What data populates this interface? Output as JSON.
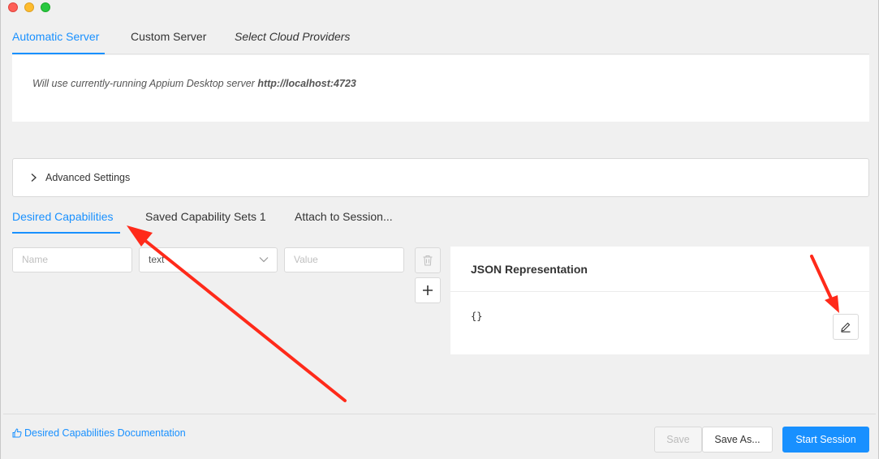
{
  "window": {
    "controls": [
      "close-button",
      "minimize-button",
      "maximize-button"
    ]
  },
  "server_tabs": [
    {
      "label": "Automatic Server",
      "active": true
    },
    {
      "label": "Custom Server",
      "active": false
    },
    {
      "label": "Select Cloud Providers",
      "active": false
    }
  ],
  "server_info": {
    "prefix": "Will use currently-running Appium Desktop server ",
    "url": "http://localhost:4723"
  },
  "advanced_settings": {
    "label": "Advanced Settings",
    "icon": "chevron-right-icon",
    "expanded": false
  },
  "capability_tabs": [
    {
      "label": "Desired Capabilities",
      "active": true
    },
    {
      "label": "Saved Capability Sets 1",
      "active": false
    },
    {
      "label": "Attach to Session...",
      "active": false
    }
  ],
  "capability_row": {
    "name_placeholder": "Name",
    "type_value": "text",
    "value_placeholder": "Value",
    "delete_icon": "trash-icon",
    "add_icon": "plus-icon"
  },
  "json_panel": {
    "title": "JSON Representation",
    "content": "{}",
    "edit_icon": "pencil-icon"
  },
  "footer": {
    "doc_link": "Desired Capabilities Documentation",
    "doc_icon": "thumbs-up-icon",
    "save_label": "Save",
    "save_as_label": "Save As...",
    "start_label": "Start Session"
  },
  "colors": {
    "accent": "#1890ff",
    "annotation_arrow": "#ff2a1a",
    "background": "#f0f0f0"
  }
}
